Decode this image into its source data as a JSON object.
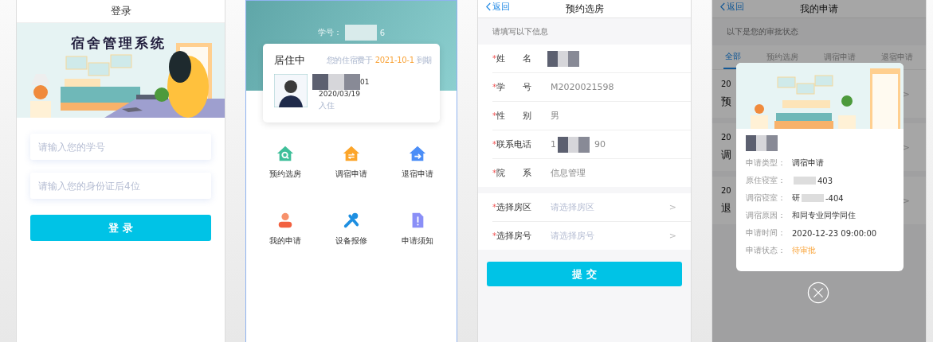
{
  "login": {
    "title": "登录",
    "banner_title": "宿舍管理系统",
    "fields": [
      {
        "placeholder": "请输入您的学号"
      },
      {
        "placeholder": "请输入您的身份证后4位"
      }
    ],
    "button": "登 录"
  },
  "home": {
    "student_label": "学号：",
    "student_suffix": "6",
    "status": "居住中",
    "expiry_prefix": "您的住宿费于",
    "expiry_date": "2021-10-1",
    "expiry_suffix": "到期",
    "room_suffix": "01",
    "checkin_date": "2020/03/19",
    "checkin_label": "入住",
    "menu": [
      {
        "label": "预约选房",
        "kind": "search"
      },
      {
        "label": "调宿申请",
        "kind": "swap"
      },
      {
        "label": "退宿申请",
        "kind": "exit"
      },
      {
        "label": "我的申请",
        "kind": "person"
      },
      {
        "label": "设备报修",
        "kind": "wrench"
      },
      {
        "label": "申请须知",
        "kind": "notice"
      }
    ]
  },
  "booking": {
    "back": "返回",
    "title": "预约选房",
    "hint": "请填写以下信息",
    "required_mark": "*",
    "fields": [
      {
        "label": "姓　　名",
        "redacted": true
      },
      {
        "label": "学　　号",
        "value_start": "M2020021598"
      },
      {
        "label": "性　　别",
        "value_start": "男"
      },
      {
        "label": "联系电话",
        "value_start": "1",
        "value_end": "90",
        "redacted": true
      },
      {
        "label": "院　　系",
        "value_start": "信息管理"
      }
    ],
    "selects": [
      {
        "label": "选择房区",
        "placeholder": "请选择房区",
        "chevron": ">"
      },
      {
        "label": "选择房号",
        "placeholder": "请选择房号",
        "chevron": ">"
      }
    ],
    "button": "提 交"
  },
  "applications": {
    "back": "返回",
    "title": "我的申请",
    "hint": "以下是您的审批状态",
    "tabs": [
      {
        "label": "全部",
        "selected": true
      },
      {
        "label": "预约选房",
        "selected": false
      },
      {
        "label": "调宿申请",
        "selected": false
      },
      {
        "label": "退宿申请",
        "selected": false
      }
    ],
    "items": [
      {
        "date": "20",
        "title": "预",
        "chevron": ">"
      },
      {
        "date": "20",
        "title": "调",
        "chevron": ">"
      },
      {
        "date": "20",
        "title": "退",
        "chevron": ">"
      }
    ],
    "modal": {
      "name_redacted": true,
      "details": [
        {
          "label": "申请类型：",
          "value_start": "调宿申请",
          "kind": "text"
        },
        {
          "label": "原住寝室：",
          "value_end": "403",
          "redacted": true
        },
        {
          "label": "调宿寝室：",
          "value_start": "研",
          "value_end": "-404",
          "kind": "text",
          "redacted": true
        },
        {
          "label": "调宿原因：",
          "value_start": "和同专业同学同住",
          "kind": "text"
        },
        {
          "label": "申请时间：",
          "value_start": "2020-12-23 09:00:00",
          "kind": "text"
        },
        {
          "label": "申请状态：",
          "value_start": "待审批",
          "kind": "status"
        }
      ]
    }
  }
}
